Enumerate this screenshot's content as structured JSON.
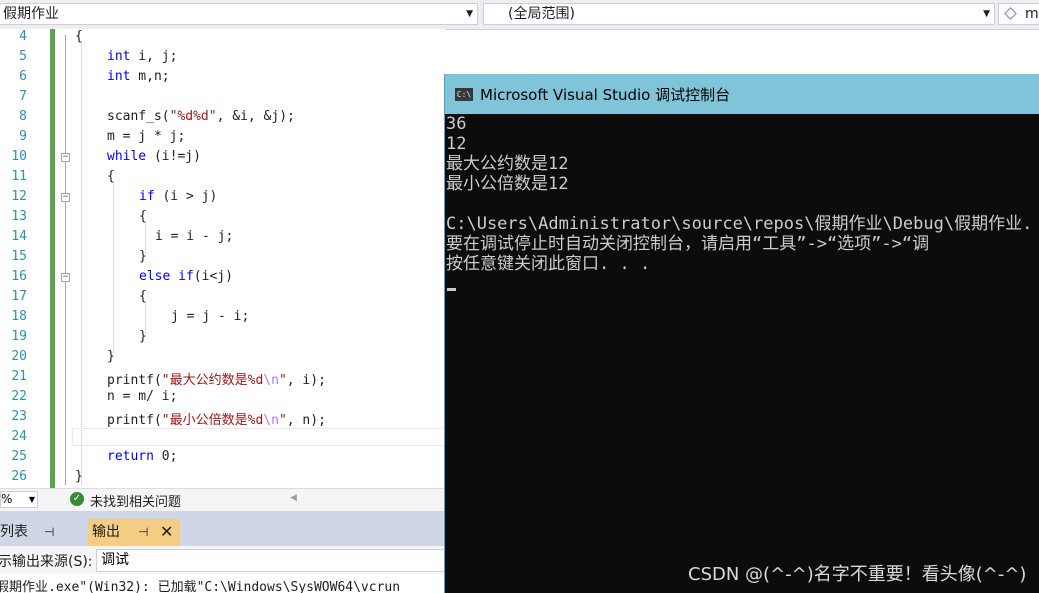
{
  "navbar": {
    "file_combo": "假期作业",
    "scope_combo": "(全局范围)",
    "member_combo": "m"
  },
  "editor": {
    "line_numbers": [
      "4",
      "5",
      "6",
      "7",
      "8",
      "9",
      "10",
      "11",
      "12",
      "13",
      "14",
      "15",
      "16",
      "17",
      "18",
      "19",
      "20",
      "21",
      "22",
      "23",
      "24",
      "25",
      "26"
    ],
    "lines": {
      "l4": "{",
      "l5_kw": "int",
      "l5_rest": " i, j;",
      "l6_kw": "int",
      "l6_rest": " m,n;",
      "l8_pre": "scanf_s(",
      "l8_str": "\"%d%d\"",
      "l8_post": ", &i, &j);",
      "l9": "m = j * j;",
      "l10_kw": "while",
      "l10_rest": " (i!=j)",
      "l11": "{",
      "l12_kw": "if",
      "l12_rest": " (i > j)",
      "l13": "{",
      "l14": "i = i - j;",
      "l15": "}",
      "l16_kw": "else if",
      "l16_rest": "(i<j)",
      "l17": "{",
      "l18": "j = j - i;",
      "l19": "}",
      "l20": "}",
      "l21_pre": "printf(",
      "l21_str": "\"最大公约数是%d",
      "l21_esc": "\\n",
      "l21_str2": "\"",
      "l21_post": ", i);",
      "l22": "n = m/ i;",
      "l23_pre": "printf(",
      "l23_str": "\"最小公倍数是%d",
      "l23_esc": "\\n",
      "l23_str2": "\"",
      "l23_post": ", n);",
      "l25_kw": "return",
      "l25_rest": " 0;",
      "l26": "}"
    }
  },
  "status": {
    "zoom": "%",
    "issues": "未找到相关问题"
  },
  "tool_window": {
    "error_list_tab": "列表",
    "output_tab": "输出",
    "source_label": "示输出来源(S):",
    "source_value": "调试",
    "output_line": "假期作业.exe\"(Win32): 已加载\"C:\\Windows\\SysWOW64\\vcrun"
  },
  "console": {
    "title": "Microsoft Visual Studio 调试控制台",
    "icon_text": "C:\\",
    "lines": [
      "36",
      "12",
      "最大公约数是12",
      "最小公倍数是12",
      "",
      "C:\\Users\\Administrator\\source\\repos\\假期作业\\Debug\\假期作业.",
      "要在调试停止时自动关闭控制台，请启用“工具”->“选项”->“调",
      "按任意键关闭此窗口. . ."
    ],
    "watermark": "CSDN @(^-^)名字不重要！看头像(^-^)"
  },
  "colors": {
    "keyword": "#0000ff",
    "string": "#a31515",
    "escape": "#b776fb",
    "line_number": "#2b91af",
    "console_title": "#7fc4d9",
    "output_tab_active": "#f5cc84"
  }
}
